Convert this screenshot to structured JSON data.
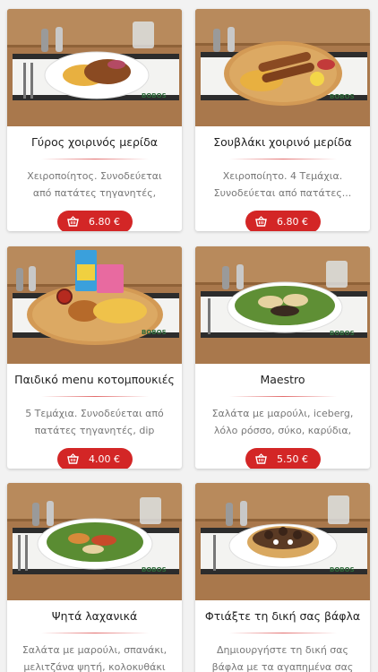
{
  "products": [
    {
      "title": "Γύρος χοιρινός μερίδα",
      "description": "Χειροποίητος. Συνοδεύεται από πατάτες τηγανητές, ντομάτα &...",
      "price": "6.80 €",
      "photo_brand": "BOBOS"
    },
    {
      "title": "Σουβλάκι χοιρινό μερίδα",
      "description": "Χειροποίητο. 4 Τεμάχια. Συνοδεύεται από πατάτες...",
      "price": "6.80 €",
      "photo_brand": "BOBOS"
    },
    {
      "title": "Παιδικό menu κοτομπουκιές",
      "description": "5 Τεμάχια. Συνοδεύεται από πατάτες τηγανητές, dip ketchup ...",
      "price": "4.00 €",
      "photo_brand": "BOBOS"
    },
    {
      "title": "Maestro",
      "description": "Σαλάτα με μαρούλι, iceberg, λόλο ρόσσο, σύκο, καρύδια, μανούρι &...",
      "price": "5.50 €",
      "photo_brand": "BOBOS"
    },
    {
      "title": "Ψητά λαχανικά",
      "description": "Σαλάτα με μαρούλι, σπανάκι, μελιτζάνα ψητή, κολοκυθάκι ψητή...",
      "price": "",
      "photo_brand": "BOBOS"
    },
    {
      "title": "Φτιάξτε τη δική σας βάφλα",
      "description": "Δημιουργήστε τη δική σας βάφλα με τα αγαπημένα σας υλικά. Η...",
      "price": "",
      "photo_brand": "BOBOS"
    }
  ],
  "icons": {
    "price_button": "basket-icon"
  },
  "colors": {
    "accent": "#d32626",
    "background": "#f2f2f2",
    "card": "#ffffff"
  }
}
